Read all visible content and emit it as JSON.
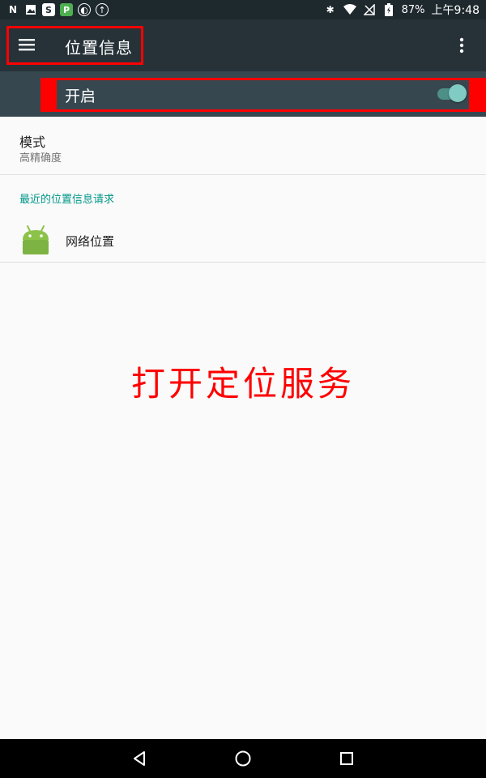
{
  "status_bar": {
    "battery_percent": "87%",
    "time": "上午9:48",
    "left_icons": [
      "n-icon",
      "image-icon",
      "s-icon",
      "p-icon",
      "globe-icon",
      "upload-icon"
    ]
  },
  "app_bar": {
    "title": "位置信息"
  },
  "master_switch": {
    "label": "开启",
    "on": true
  },
  "mode": {
    "title": "模式",
    "subtitle": "高精确度"
  },
  "recent_requests": {
    "header": "最近的位置信息请求",
    "items": [
      {
        "label": "网络位置"
      }
    ]
  },
  "annotation": {
    "text": "打开定位服务",
    "color": "#ff0000"
  },
  "colors": {
    "app_bar": "#263238",
    "switch_bar": "#37474f",
    "accent": "#009688",
    "toggle_thumb": "#80cbc4"
  }
}
